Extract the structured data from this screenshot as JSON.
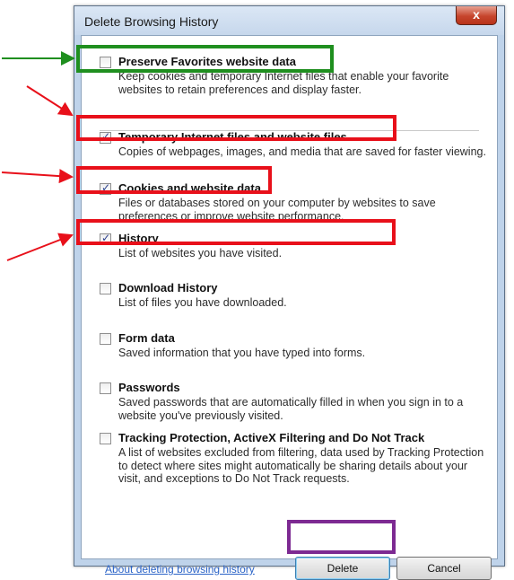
{
  "dialog": {
    "title": "Delete Browsing History",
    "close_label": "x"
  },
  "options": [
    {
      "title": "Preserve Favorites website data",
      "desc": "Keep cookies and temporary Internet files that enable your favorite websites to retain preferences and display faster.",
      "checked": false
    },
    {
      "title": "Temporary Internet files and website files",
      "desc": "Copies of webpages, images, and media that are saved for faster viewing.",
      "checked": true
    },
    {
      "title": "Cookies and website data",
      "desc": "Files or databases stored on your computer by websites to save preferences or improve website performance.",
      "checked": true
    },
    {
      "title": "History",
      "desc": "List of websites you have visited.",
      "checked": true
    },
    {
      "title": "Download History",
      "desc": "List of files you have downloaded.",
      "checked": false
    },
    {
      "title": "Form data",
      "desc": "Saved information that you have typed into forms.",
      "checked": false
    },
    {
      "title": "Passwords",
      "desc": "Saved passwords that are automatically filled in when you sign in to a website you've previously visited.",
      "checked": false
    },
    {
      "title": "Tracking Protection, ActiveX Filtering and Do Not Track",
      "desc": "A list of websites excluded from filtering, data used by Tracking Protection to detect where sites might automatically be sharing details about your visit, and exceptions to Do Not Track requests.",
      "checked": false
    }
  ],
  "footer": {
    "link": "About deleting browsing history",
    "delete_label": "Delete",
    "cancel_label": "Cancel"
  },
  "colors": {
    "highlight_green": "#1f8f1f",
    "highlight_red": "#e8101a",
    "highlight_purple": "#7d2a92"
  }
}
